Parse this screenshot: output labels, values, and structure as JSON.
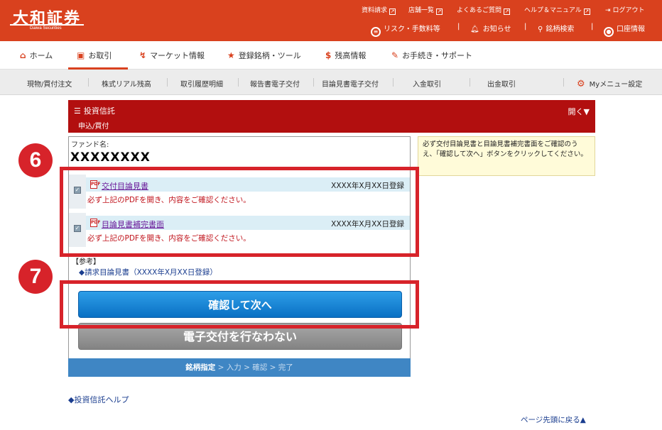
{
  "header": {
    "logo": "大和証券",
    "logo_sub": "Daiwa Securities",
    "top_links": {
      "materials": "資料請求",
      "branches": "店舗一覧",
      "faq": "よくあるご質問",
      "help": "ヘルプ＆マニュアル",
      "logout": "ログアウト"
    },
    "sub_links": {
      "risk": "リスク・手数料等",
      "notice": "お知らせ",
      "search": "銘柄検索",
      "account": "口座情報"
    }
  },
  "main_nav": {
    "home": "ホーム",
    "trade": "お取引",
    "market": "マーケット情報",
    "watchlist": "登録銘柄・ツール",
    "balance": "残高情報",
    "procedures": "お手続き・サポート"
  },
  "sub_nav": {
    "items": [
      "現物/買付注文",
      "株式リアル残高",
      "取引履歴明細",
      "報告書電子交付",
      "目論見書電子交付",
      "入金取引",
      "出金取引"
    ],
    "my_menu": "Myメニュー設定"
  },
  "section": {
    "title": "投資信託",
    "subtitle": "申込/買付",
    "toggle": "開く▼"
  },
  "fund": {
    "label": "ファンド名:",
    "name": "XXXXXXXX"
  },
  "notice": "必ず交付目論見書と目論見書補完書面をご確認のうえ、「確認して次へ」ボタンをクリックしてください。",
  "documents": [
    {
      "title": "交付目論見書",
      "date": "XXXX年X月XX日登録",
      "note": "必ず上記のPDFを開き、内容をご確認ください。"
    },
    {
      "title": "目論見書補完書面",
      "date": "XXXX年X月XX日登録",
      "note": "必ず上記のPDFを開き、内容をご確認ください。"
    }
  ],
  "reference": {
    "label": "【参考】",
    "link": "◆請求目論見書（XXXX年X月XX日登録）"
  },
  "buttons": {
    "confirm": "確認して次へ",
    "no_delivery": "電子交付を行なわない"
  },
  "steps": {
    "current": "銘柄指定",
    "rest": "> 入力 > 確認 > 完了"
  },
  "annotations": {
    "badge_6": "6",
    "badge_7": "7"
  },
  "footer": {
    "help": "◆投資信託ヘルプ",
    "pagetop": "ページ先頭に戻る▲"
  }
}
